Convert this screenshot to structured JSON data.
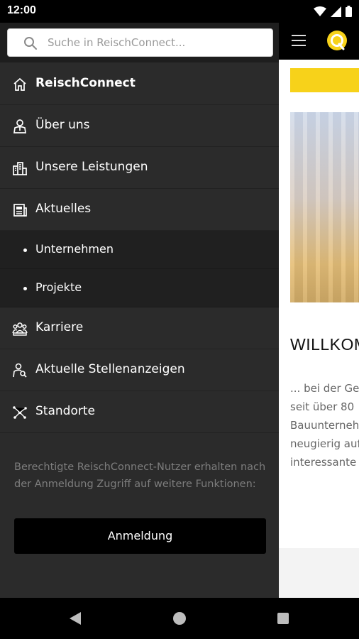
{
  "status_bar": {
    "time": "12:00"
  },
  "search": {
    "placeholder": "Suche in ReischConnect..."
  },
  "menu": {
    "items": [
      {
        "label": "ReischConnect",
        "icon": "home-icon",
        "active": true
      },
      {
        "label": "Über uns",
        "icon": "person-icon"
      },
      {
        "label": "Unsere Leistungen",
        "icon": "buildings-icon"
      },
      {
        "label": "Aktuelles",
        "icon": "news-icon"
      },
      {
        "label": "Unternehmen",
        "sub": true
      },
      {
        "label": "Projekte",
        "sub": true
      },
      {
        "label": "Karriere",
        "icon": "group-icon"
      },
      {
        "label": "Aktuelle Stellenanzeigen",
        "icon": "job-search-icon"
      },
      {
        "label": "Standorte",
        "icon": "network-icon"
      }
    ]
  },
  "info": {
    "text": "Berechtigte ReischConnect-Nutzer erhalten nach der Anmeldung Zugriff auf weitere Funktionen:"
  },
  "login": {
    "label": "Anmeldung"
  },
  "background_page": {
    "heading": "WILLKOMMEN",
    "text_lines": [
      "... bei der Gesellschaft,",
      "seit über 80",
      "Bauunternehmen",
      "neugierig auf",
      "interessante"
    ]
  },
  "colors": {
    "accent": "#f7d21a",
    "drawer": "#2b2b2b",
    "submenu": "#202020"
  }
}
